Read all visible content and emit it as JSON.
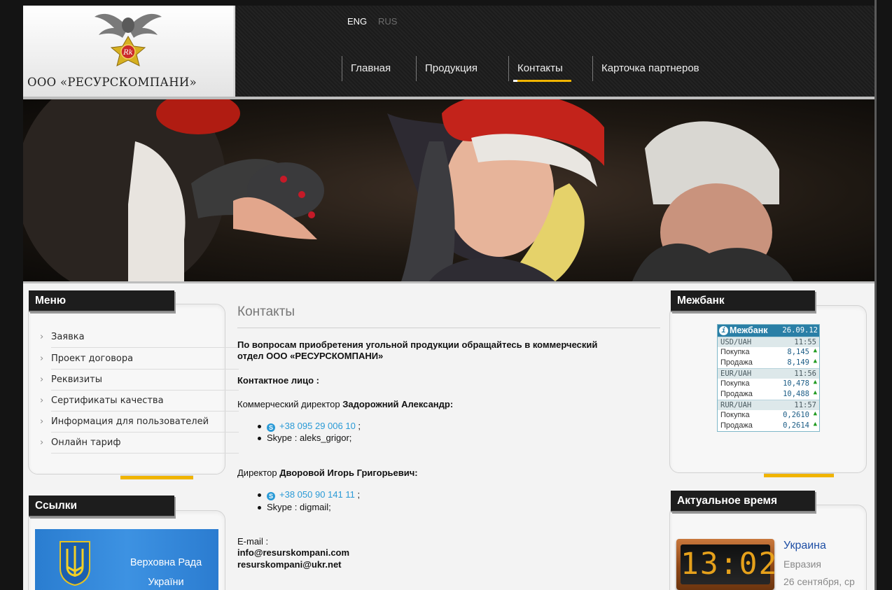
{
  "header": {
    "logo_text": "ООО «РЕСУРСКОМПАНИ»",
    "lang": {
      "eng": "ENG",
      "rus": "RUS"
    },
    "nav": [
      {
        "label": "Главная"
      },
      {
        "label": "Продукция"
      },
      {
        "label": "Контакты",
        "active": true
      },
      {
        "label": "Карточка партнеров"
      }
    ],
    "accent_color": "#f0b400"
  },
  "left": {
    "menu_title": "Меню",
    "menu": [
      "Заявка",
      "Проект договора",
      "Реквизиты",
      "Сертификаты качества",
      "Информация для пользователей",
      "Онлайн тариф"
    ],
    "links_title": "Ссылки",
    "rada": "Верховна Рада України"
  },
  "content": {
    "title": "Контакты",
    "intro": "По вопросам приобретения угольной продукции обращайтесь в коммерческий отдел ООО «РЕСУРСКОМПАНИ»",
    "contact_label": "Контактное лицо :",
    "person1": {
      "role": "Коммерческий директор ",
      "name": "Задорожний Александр:",
      "phone": "+38 095 29 006 10",
      "skype": "Skype : aleks_grigor;"
    },
    "person2": {
      "role": "Директор ",
      "name": "Дворовой Игорь Григорьевич:",
      "phone": "+38 050 90 141 11",
      "skype": "Skype : digmail;"
    },
    "email_label": "E-mail :",
    "emails": [
      "info@resurskompani.com",
      "resurskompani@ukr.net"
    ]
  },
  "right": {
    "fx_title": "Межбанк",
    "fx": {
      "name": "Межбанк",
      "date": "26.09.12",
      "blocks": [
        {
          "pair": "USD/UAH",
          "time": "11:55",
          "buy": "8,145",
          "sell": "8,149"
        },
        {
          "pair": "EUR/UAH",
          "time": "11:56",
          "buy": "10,478",
          "sell": "10,488"
        },
        {
          "pair": "RUR/UAH",
          "time": "11:57",
          "buy": "0,2610",
          "sell": "0,2614"
        }
      ],
      "buy_label": "Покупка",
      "sell_label": "Продажа"
    },
    "time_title": "Актуальное время",
    "clock": "13:02",
    "country": "Украина",
    "region": "Евразия",
    "date": "26 сентября, ср"
  }
}
